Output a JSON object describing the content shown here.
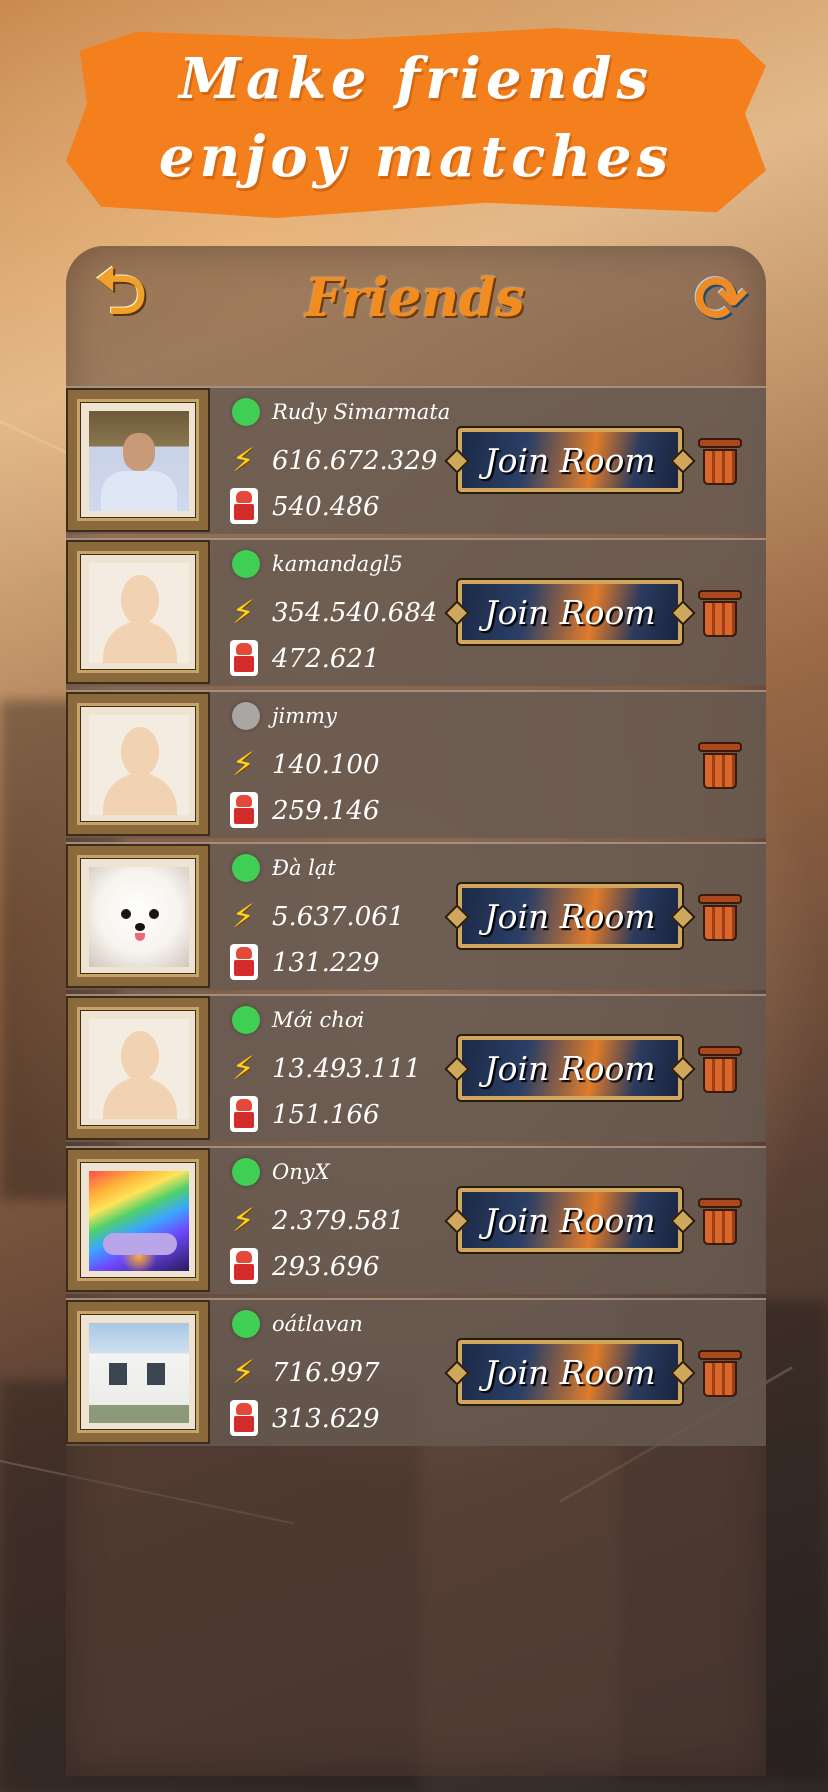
{
  "banner": {
    "line1": "Make friends",
    "line2": "enjoy matches"
  },
  "header": {
    "title": "Friends",
    "back_icon": "back-arrow-icon",
    "refresh_icon": "refresh-icon"
  },
  "friends": [
    {
      "name": "Rudy Simarmata",
      "online": true,
      "energy": "616.672.329",
      "score": "540.486",
      "avatar": "photo",
      "join_label": "Join Room",
      "show_join": true
    },
    {
      "name": "kamandagl5",
      "online": true,
      "energy": "354.540.684",
      "score": "472.621",
      "avatar": "default",
      "join_label": "Join Room",
      "show_join": true
    },
    {
      "name": "jimmy",
      "online": false,
      "energy": "140.100",
      "score": "259.146",
      "avatar": "default",
      "join_label": "",
      "show_join": false
    },
    {
      "name": "Đà lạt",
      "online": true,
      "energy": "5.637.061",
      "score": "131.229",
      "avatar": "dog",
      "join_label": "Join Room",
      "show_join": true
    },
    {
      "name": "Mới chơi",
      "online": true,
      "energy": "13.493.111",
      "score": "151.166",
      "avatar": "default",
      "join_label": "Join Room",
      "show_join": true
    },
    {
      "name": "OnyX",
      "online": true,
      "energy": "2.379.581",
      "score": "293.696",
      "avatar": "rainbow",
      "join_label": "Join Room",
      "show_join": true
    },
    {
      "name": "oátlavan",
      "online": true,
      "energy": "716.997",
      "score": "313.629",
      "avatar": "house",
      "join_label": "Join Room",
      "show_join": true
    }
  ],
  "colors": {
    "accent": "#f47f1d",
    "online": "#3fcf55",
    "offline": "#a9a6a4"
  }
}
